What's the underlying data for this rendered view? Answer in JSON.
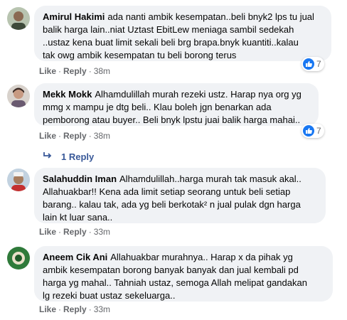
{
  "labels": {
    "like": "Like",
    "reply": "Reply",
    "dot": "·"
  },
  "comments": [
    {
      "author": "Amirul Hakimi",
      "lines": [
        "ada nanti ambik kesempatan..beli bnyk2 lps tu jual",
        "balik harga lain..niat Uztast EbitLew meniaga sambil sedekah",
        "..ustaz kena buat limit sekali beli brg brapa.bnyk kuantiti..kalau",
        "tak owg ambik kesempatan tu beli borong terus"
      ],
      "time": "38m",
      "reactions": "7"
    },
    {
      "author": "Mekk Mokk",
      "lines": [
        "Alhamdulillah murah rezeki ustz. Harap nya org yg",
        "mmg x mampu je dtg beli.. Klau boleh jgn benarkan ada",
        "pemborong atau buyer.. Beli bnyk lpstu juai balik harga mahai.."
      ],
      "time": "38m",
      "reactions": "7",
      "reply_count_label": "1 Reply"
    },
    {
      "author": "Salahuddin Iman",
      "lines": [
        "Alhamdulillah..harga murah tak masuk akal..",
        "Allahuakbar!! Kena ada limit setiap seorang untuk beli setiap",
        "barang.. kalau tak, ada yg beli berkotak² n jual pulak dgn harga",
        "lain kt luar sana.."
      ],
      "time": "33m"
    },
    {
      "author": "Aneem Cik Ani",
      "lines": [
        "Allahuakbar murahnya.. Harap x da pihak yg",
        "ambik kesempatan borong banyak banyak dan jual kembali pd",
        "harga yg mahal.. Tahniah ustaz, semoga Allah melipat gandakan",
        "lg rezeki buat ustaz sekeluarga.."
      ],
      "time": "33m"
    }
  ]
}
